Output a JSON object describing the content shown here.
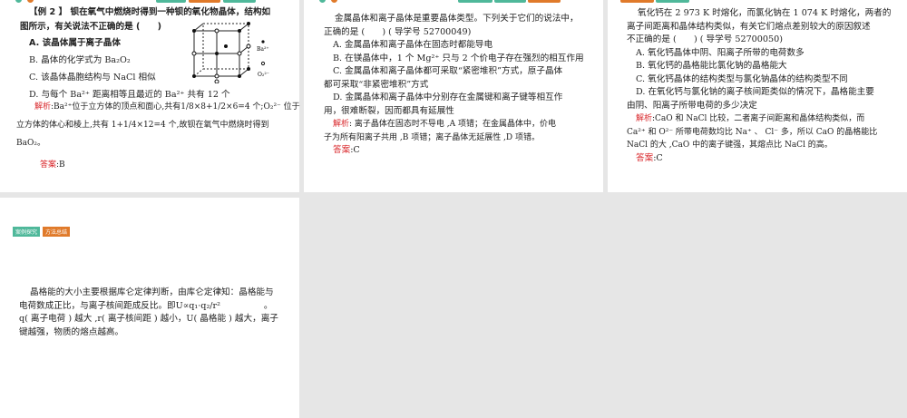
{
  "panel1": {
    "q_title": "【例 2 】 钡在氧气中燃烧时得到一种钡的氧化物晶体，结构如",
    "q_title2": "图所示，有关说法不正确的是 (　　)",
    "options": [
      "A. 该晶体属于离子晶体",
      "B. 晶体的化学式为 Ba₂O₂",
      "C. 该晶体晶胞结构与 NaCl 相似",
      "D. 与每个 Ba²⁺ 距离相等且最近的 Ba²⁺ 共有 12 个"
    ],
    "legend": [
      "Ba²⁺",
      "O₂²⁻"
    ],
    "analysis_label": "解析",
    "analysis": [
      ":Ba²⁺位于立方体的顶点和面心,共有1/8×8+1/2×6=4 个;O₂²⁻ 位于",
      "立方体的体心和棱上,共有 1+1/4×12=4 个,故钡在氧气中燃烧时得到",
      "BaO₂。"
    ],
    "answer_label": "答案",
    "answer": ":B"
  },
  "panel2": {
    "question": [
      "金属晶体和离子晶体是重要晶体类型。下列关于它们的说法中，",
      "正确的是 (　　) ( 导学号 52700049)"
    ],
    "options": [
      "A. 金属晶体和离子晶体在固态时都能导电",
      "B. 在镁晶体中，1 个 Mg²⁺ 只与 2 个价电子存在强烈的相互作用",
      "C. 金属晶体和离子晶体都可采取“紧密堆积”方式，原子晶体",
      "都可采取“非紧密堆积”方式",
      "D. 金属晶体和离子晶体中分别存在金属键和离子键等相互作",
      "用，很难断裂，因而都具有延展性"
    ],
    "analysis_label": "解析",
    "analysis": [
      ": 离子晶体在固态时不导电 ,A 项错；在金属晶体中，价电",
      "子为所有阳离子共用 ,B 项错；离子晶体无延展性 ,D 项错。"
    ],
    "answer_label": "答案",
    "answer": ":C"
  },
  "panel3": {
    "question": [
      "氧化钙在 2 973 K 时熔化，而氯化钠在 1 074 K 时熔化，两者的",
      "离子间距离和晶体结构类似，有关它们熔点差别较大的原因叙述",
      "不正确的是 (　　) ( 导学号 52700050)"
    ],
    "options": [
      "A. 氧化钙晶体中阴、阳离子所带的电荷数多",
      "B. 氧化钙的晶格能比氯化钠的晶格能大",
      "C. 氧化钙晶体的结构类型与氯化钠晶体的结构类型不同",
      "D. 在氧化钙与氯化钠的离子核间距类似的情况下，晶格能主要",
      "由阴、阳离子所带电荷的多少决定"
    ],
    "analysis_label": "解析",
    "analysis": [
      ":CaO 和 NaCl 比较，二者离子间距离和晶体结构类似，而",
      "Ca²⁺ 和 O²⁻ 所带电荷数均比 Na⁺ 、 Cl⁻ 多，所以 CaO 的晶格能比",
      "NaCl 的大 ,CaO 中的离子键强，其熔点比 NaCl 的高。"
    ],
    "answer_label": "答案",
    "answer": ":C"
  },
  "panel4": {
    "tags": [
      "案例探究",
      "方法总结"
    ],
    "text": [
      "晶格能的大小主要根据库仑定律判断，由库仑定律知：晶格能与",
      "电荷数成正比，与离子核间距成反比。即U∝q₁·q₂/r²　　　　　。",
      "q( 离子电荷 ) 越大 ,r( 离子核间距 ) 越小，U( 晶格能 ) 越大，离子",
      "键越强，物质的熔点越高。"
    ]
  },
  "colors": {
    "green": "#4fb89a",
    "orange": "#e07a2a",
    "red": "#d9262a"
  }
}
